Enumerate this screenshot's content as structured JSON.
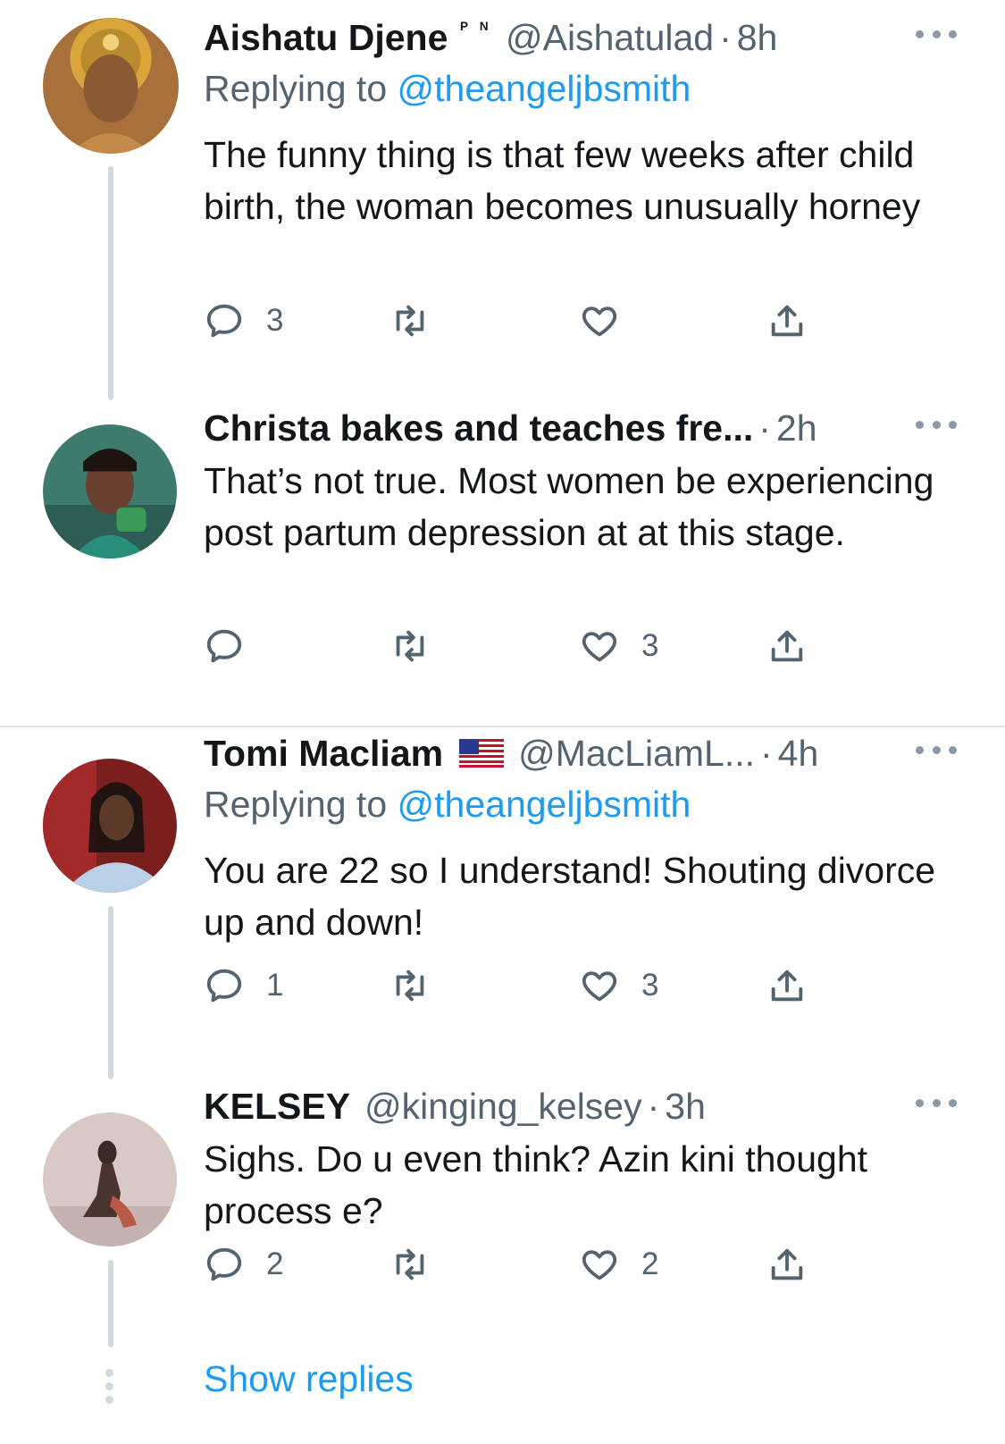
{
  "replies": [
    {
      "name": "Aishatu Djene",
      "badge": "ᴾ ᴺ",
      "handle": "@Aishatulad",
      "time": "8h",
      "replying_label": "Replying to",
      "replying_to": "@theangeljbsmith",
      "text": "The funny thing is that few weeks after child birth, the woman becomes unusually horney",
      "reply_count": "3",
      "retweet_count": "",
      "like_count": ""
    },
    {
      "name": "Christa bakes and teaches fre...",
      "time": "2h",
      "text": "That’s not true. Most women be experiencing post partum depression at at this stage.",
      "reply_count": "",
      "retweet_count": "",
      "like_count": "3"
    },
    {
      "name": "Tomi Macliam",
      "handle": "@MacLiamL...",
      "time": "4h",
      "replying_label": "Replying to",
      "replying_to": "@theangeljbsmith",
      "text": "You are 22 so I understand! Shouting divorce up and down!",
      "reply_count": "1",
      "retweet_count": "",
      "like_count": "3"
    },
    {
      "name": "KELSEY",
      "handle": "@kinging_kelsey",
      "time": "3h",
      "text": "Sighs. Do u even think? Azin kini thought process e?",
      "reply_count": "2",
      "retweet_count": "",
      "like_count": "2"
    }
  ],
  "separator_dot": "·",
  "show_replies_label": "Show replies",
  "icons": {
    "reply": "reply-icon",
    "retweet": "retweet-icon",
    "like": "heart-icon",
    "share": "share-icon",
    "more": "more-icon",
    "flag": "us-flag-icon"
  },
  "colors": {
    "link": "#1d9bf0",
    "muted": "#536471",
    "thread_line": "#cfd9de"
  }
}
